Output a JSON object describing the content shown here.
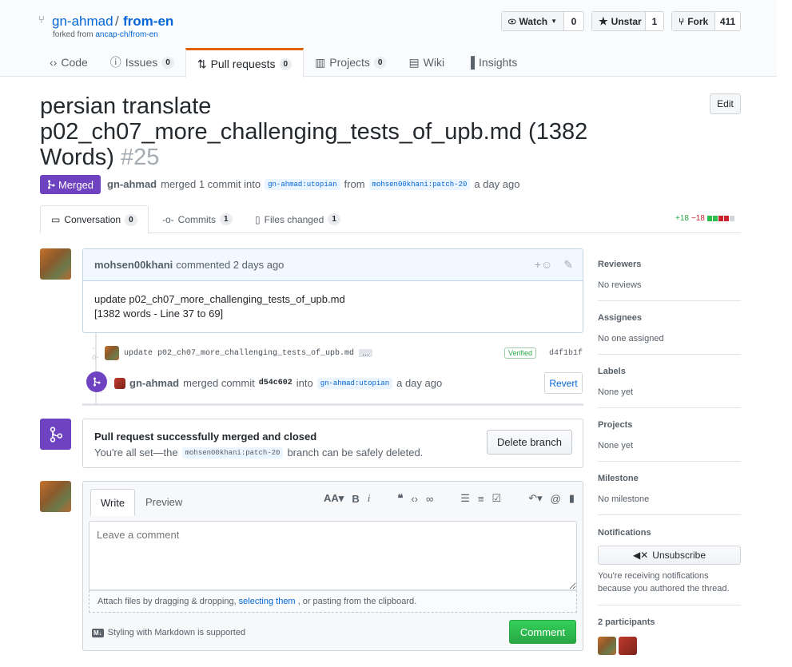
{
  "repo": {
    "owner": "gn-ahmad",
    "separator": "/",
    "name": "from-en",
    "forked_prefix": "forked from ",
    "forked_from": "ancap-ch/from-en"
  },
  "actions": {
    "watch_label": "Watch",
    "watch_count": "0",
    "unstar_label": "Unstar",
    "star_count": "1",
    "fork_label": "Fork",
    "fork_count": "411"
  },
  "reponav": [
    {
      "label": "Code",
      "count": ""
    },
    {
      "label": "Issues",
      "count": "0"
    },
    {
      "label": "Pull requests",
      "count": "0"
    },
    {
      "label": "Projects",
      "count": "0"
    },
    {
      "label": "Wiki",
      "count": ""
    },
    {
      "label": "Insights",
      "count": ""
    }
  ],
  "pr": {
    "title": "persian translate p02_ch07_more_challenging_tests_of_upb.md (1382 Words)",
    "number": "#25",
    "edit_label": "Edit",
    "state": "Merged",
    "author": "gn-ahmad",
    "merged_text": "merged 1 commit into",
    "base_branch": "gn-ahmad:utopian",
    "from_text": "from",
    "head_branch": "mohsen00khani:patch-20",
    "when": "a day ago"
  },
  "tabs": {
    "conversation": {
      "label": "Conversation",
      "count": "0"
    },
    "commits": {
      "label": "Commits",
      "count": "1"
    },
    "files": {
      "label": "Files changed",
      "count": "1"
    }
  },
  "diffstat": {
    "additions": "+18",
    "deletions": "−18"
  },
  "comment": {
    "author": "mohsen00khani",
    "action": "commented 2 days ago",
    "line1": "update p02_ch07_more_challenging_tests_of_upb.md",
    "line2": "[1382 words - Line 37 to 69]"
  },
  "commit": {
    "message": "update p02_ch07_more_challenging_tests_of_upb.md",
    "ellipsis": "…",
    "verified": "Verified",
    "sha": "d4f1b1f"
  },
  "merge_event": {
    "actor": "gn-ahmad",
    "text": "merged commit",
    "sha": "d54c602",
    "into": "into",
    "branch": "gn-ahmad:utopian",
    "when": "a day ago",
    "revert_label": "Revert"
  },
  "merged_box": {
    "title": "Pull request successfully merged and closed",
    "prefix": "You're all set—the",
    "branch": "mohsen00khani:patch-20",
    "suffix": "branch can be safely deleted.",
    "delete_label": "Delete branch"
  },
  "editor": {
    "write_tab": "Write",
    "preview_tab": "Preview",
    "placeholder": "Leave a comment",
    "attach_prefix": "Attach files by dragging & dropping,",
    "attach_link": "selecting them",
    "attach_suffix": ", or pasting from the clipboard.",
    "markdown_note": "Styling with Markdown is supported",
    "comment_button": "Comment"
  },
  "sidebar": {
    "reviewers": {
      "heading": "Reviewers",
      "value": "No reviews"
    },
    "assignees": {
      "heading": "Assignees",
      "value": "No one assigned"
    },
    "labels": {
      "heading": "Labels",
      "value": "None yet"
    },
    "projects": {
      "heading": "Projects",
      "value": "None yet"
    },
    "milestone": {
      "heading": "Milestone",
      "value": "No milestone"
    },
    "notifications": {
      "heading": "Notifications",
      "button": "Unsubscribe",
      "note": "You're receiving notifications because you authored the thread."
    },
    "participants": {
      "heading": "2 participants"
    }
  },
  "colors": {
    "merged": "#6f42c1",
    "link": "#0366d6",
    "success": "#28a745",
    "danger": "#cb2431",
    "tab_accent": "#e36209"
  }
}
